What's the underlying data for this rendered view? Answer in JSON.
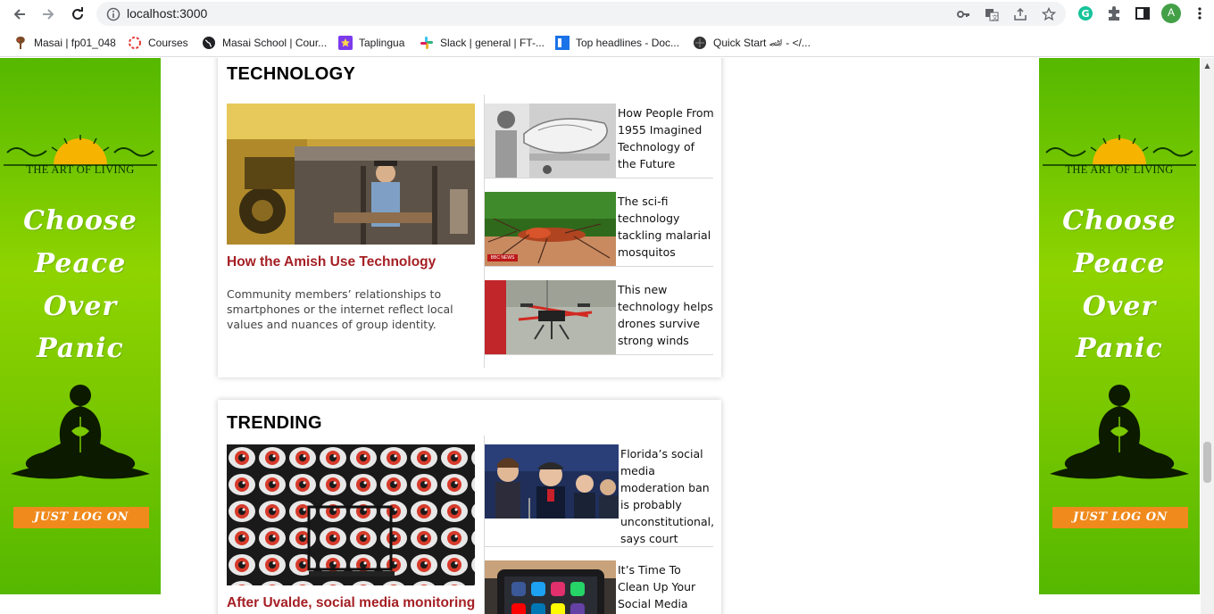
{
  "browser": {
    "url": "localhost:3000",
    "profile_initial": "A",
    "profile_color": "#43a047",
    "bookmarks": [
      {
        "label": "Masai | fp01_048",
        "icon": "masai-icon"
      },
      {
        "label": "Courses",
        "icon": "courses-icon"
      },
      {
        "label": "Masai School | Cour...",
        "icon": "globe-icon"
      },
      {
        "label": "Taplingua",
        "icon": "taplingua-icon"
      },
      {
        "label": "Slack | general | FT-...",
        "icon": "slack-icon"
      },
      {
        "label": "Top headlines - Doc...",
        "icon": "docs-icon"
      },
      {
        "label": "Quick Start 🏎 - </...",
        "icon": "quickstart-icon"
      }
    ]
  },
  "ads": {
    "brand": "THE ART OF LIVING",
    "tagline": [
      "Choose",
      "Peace",
      "Over",
      "Panic"
    ],
    "cta": "JUST LOG ON",
    "background_color": "#7ac800",
    "cta_color": "#f08a1c"
  },
  "sections": {
    "technology": {
      "title": "TECHNOLOGY",
      "lead": {
        "title": "How the Amish Use Technology",
        "description": "Community members’ relationships to smartphones or the internet reflect local values and nuances of group identity."
      },
      "items": [
        {
          "title": "How People From 1955 Imagined Technology of the Future"
        },
        {
          "title": "The sci-fi technology tackling malarial mosquitos",
          "badge": "BBC NEWS"
        },
        {
          "title": "This new technology helps drones survive strong winds"
        }
      ]
    },
    "trending": {
      "title": "TRENDING",
      "lead": {
        "title": "After Uvalde, social media monitoring"
      },
      "items": [
        {
          "title": "Florida’s social media moderation ban is probably unconstitutional, says court"
        },
        {
          "title": "It’s Time To Clean Up Your Social Media Profiles"
        }
      ]
    }
  },
  "colors": {
    "headline_red": "#a51f24",
    "section_title": "#000000"
  }
}
